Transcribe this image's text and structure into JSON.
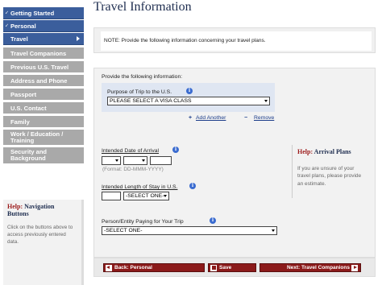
{
  "sidebar": {
    "items": [
      {
        "label": "Getting Started",
        "state": "completed"
      },
      {
        "label": "Personal",
        "state": "completed"
      },
      {
        "label": "Travel",
        "state": "current"
      },
      {
        "label": "Travel Companions",
        "state": "pending"
      },
      {
        "label": "Previous U.S. Travel",
        "state": "pending"
      },
      {
        "label": "Address and Phone",
        "state": "pending"
      },
      {
        "label": "Passport",
        "state": "pending"
      },
      {
        "label": "U.S. Contact",
        "state": "pending"
      },
      {
        "label": "Family",
        "state": "pending"
      },
      {
        "label_line1": "Work / Education /",
        "label_line2": "Training",
        "state": "pending"
      },
      {
        "label_line1": "Security and",
        "label_line2": "Background",
        "state": "pending"
      }
    ],
    "help": {
      "prefix": "Help:",
      "title": "Navigation Buttons",
      "text": "Click on the buttons above to access previously entered data."
    }
  },
  "page": {
    "title": "Travel Information",
    "note": "NOTE: Provide the following information concerning your travel plans."
  },
  "form": {
    "intro": "Provide the following information:",
    "purpose_label": "Purpose of Trip to the U.S.",
    "purpose_value": "PLEASE SELECT A VISA CLASS",
    "add_another": "Add Another",
    "remove": "Remove",
    "arrival_label": "Intended Date of Arrival",
    "arrival_format": "(Format: DD-MMM-YYYY)",
    "length_label": "Intended Length of Stay in U.S.",
    "length_unit_value": "-SELECT ONE-",
    "paying_label": "Person/Entity Paying for Your Trip",
    "paying_value": "-SELECT ONE-"
  },
  "arrival_help": {
    "prefix": "Help:",
    "title": "Arrival Plans",
    "text": "If you are unsure of your travel plans, please provide an estimate."
  },
  "buttons": {
    "back": "Back: Personal",
    "save": "Save",
    "next": "Next: Travel Companions"
  },
  "colors": {
    "nav_blue": "#3b5e9c",
    "nav_gray": "#a9a9a9",
    "button_red": "#8b1a1a",
    "title_navy": "#1e2d4f"
  }
}
